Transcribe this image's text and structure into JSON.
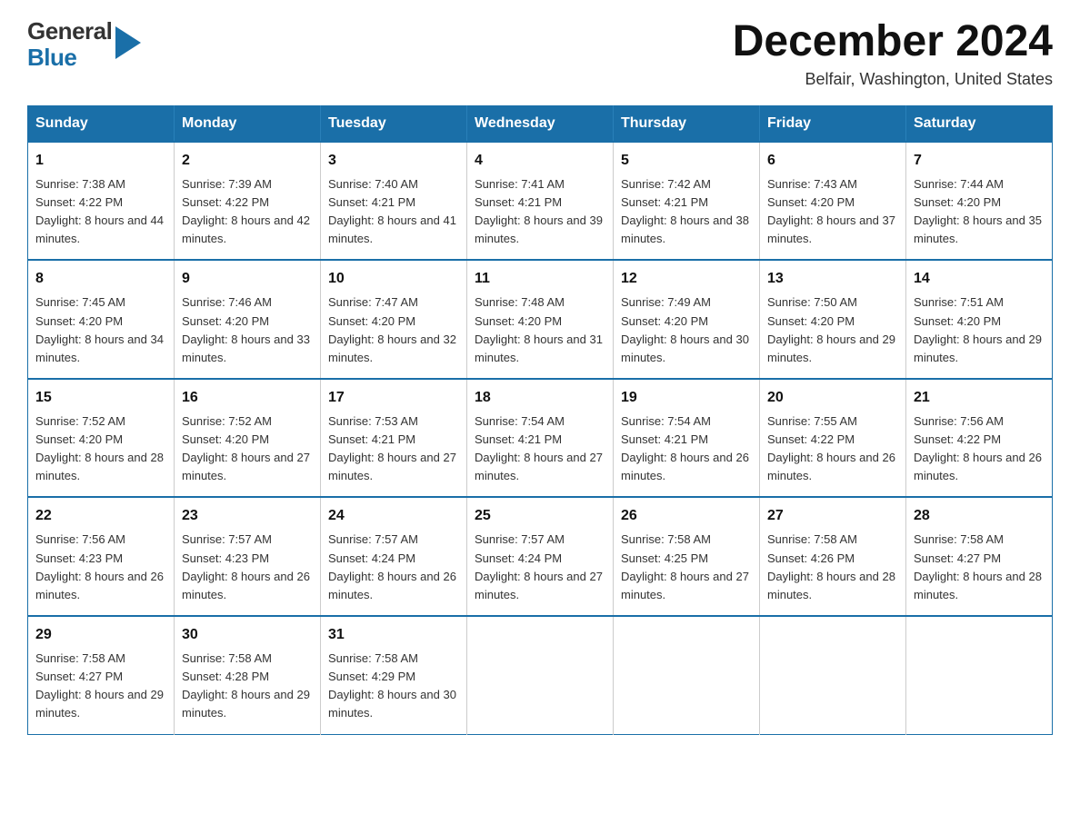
{
  "header": {
    "logo": {
      "general": "General",
      "blue": "Blue",
      "arrow": "▶"
    },
    "title": "December 2024",
    "subtitle": "Belfair, Washington, United States"
  },
  "days_of_week": [
    "Sunday",
    "Monday",
    "Tuesday",
    "Wednesday",
    "Thursday",
    "Friday",
    "Saturday"
  ],
  "weeks": [
    [
      {
        "day": "1",
        "sunrise": "Sunrise: 7:38 AM",
        "sunset": "Sunset: 4:22 PM",
        "daylight": "Daylight: 8 hours and 44 minutes."
      },
      {
        "day": "2",
        "sunrise": "Sunrise: 7:39 AM",
        "sunset": "Sunset: 4:22 PM",
        "daylight": "Daylight: 8 hours and 42 minutes."
      },
      {
        "day": "3",
        "sunrise": "Sunrise: 7:40 AM",
        "sunset": "Sunset: 4:21 PM",
        "daylight": "Daylight: 8 hours and 41 minutes."
      },
      {
        "day": "4",
        "sunrise": "Sunrise: 7:41 AM",
        "sunset": "Sunset: 4:21 PM",
        "daylight": "Daylight: 8 hours and 39 minutes."
      },
      {
        "day": "5",
        "sunrise": "Sunrise: 7:42 AM",
        "sunset": "Sunset: 4:21 PM",
        "daylight": "Daylight: 8 hours and 38 minutes."
      },
      {
        "day": "6",
        "sunrise": "Sunrise: 7:43 AM",
        "sunset": "Sunset: 4:20 PM",
        "daylight": "Daylight: 8 hours and 37 minutes."
      },
      {
        "day": "7",
        "sunrise": "Sunrise: 7:44 AM",
        "sunset": "Sunset: 4:20 PM",
        "daylight": "Daylight: 8 hours and 35 minutes."
      }
    ],
    [
      {
        "day": "8",
        "sunrise": "Sunrise: 7:45 AM",
        "sunset": "Sunset: 4:20 PM",
        "daylight": "Daylight: 8 hours and 34 minutes."
      },
      {
        "day": "9",
        "sunrise": "Sunrise: 7:46 AM",
        "sunset": "Sunset: 4:20 PM",
        "daylight": "Daylight: 8 hours and 33 minutes."
      },
      {
        "day": "10",
        "sunrise": "Sunrise: 7:47 AM",
        "sunset": "Sunset: 4:20 PM",
        "daylight": "Daylight: 8 hours and 32 minutes."
      },
      {
        "day": "11",
        "sunrise": "Sunrise: 7:48 AM",
        "sunset": "Sunset: 4:20 PM",
        "daylight": "Daylight: 8 hours and 31 minutes."
      },
      {
        "day": "12",
        "sunrise": "Sunrise: 7:49 AM",
        "sunset": "Sunset: 4:20 PM",
        "daylight": "Daylight: 8 hours and 30 minutes."
      },
      {
        "day": "13",
        "sunrise": "Sunrise: 7:50 AM",
        "sunset": "Sunset: 4:20 PM",
        "daylight": "Daylight: 8 hours and 29 minutes."
      },
      {
        "day": "14",
        "sunrise": "Sunrise: 7:51 AM",
        "sunset": "Sunset: 4:20 PM",
        "daylight": "Daylight: 8 hours and 29 minutes."
      }
    ],
    [
      {
        "day": "15",
        "sunrise": "Sunrise: 7:52 AM",
        "sunset": "Sunset: 4:20 PM",
        "daylight": "Daylight: 8 hours and 28 minutes."
      },
      {
        "day": "16",
        "sunrise": "Sunrise: 7:52 AM",
        "sunset": "Sunset: 4:20 PM",
        "daylight": "Daylight: 8 hours and 27 minutes."
      },
      {
        "day": "17",
        "sunrise": "Sunrise: 7:53 AM",
        "sunset": "Sunset: 4:21 PM",
        "daylight": "Daylight: 8 hours and 27 minutes."
      },
      {
        "day": "18",
        "sunrise": "Sunrise: 7:54 AM",
        "sunset": "Sunset: 4:21 PM",
        "daylight": "Daylight: 8 hours and 27 minutes."
      },
      {
        "day": "19",
        "sunrise": "Sunrise: 7:54 AM",
        "sunset": "Sunset: 4:21 PM",
        "daylight": "Daylight: 8 hours and 26 minutes."
      },
      {
        "day": "20",
        "sunrise": "Sunrise: 7:55 AM",
        "sunset": "Sunset: 4:22 PM",
        "daylight": "Daylight: 8 hours and 26 minutes."
      },
      {
        "day": "21",
        "sunrise": "Sunrise: 7:56 AM",
        "sunset": "Sunset: 4:22 PM",
        "daylight": "Daylight: 8 hours and 26 minutes."
      }
    ],
    [
      {
        "day": "22",
        "sunrise": "Sunrise: 7:56 AM",
        "sunset": "Sunset: 4:23 PM",
        "daylight": "Daylight: 8 hours and 26 minutes."
      },
      {
        "day": "23",
        "sunrise": "Sunrise: 7:57 AM",
        "sunset": "Sunset: 4:23 PM",
        "daylight": "Daylight: 8 hours and 26 minutes."
      },
      {
        "day": "24",
        "sunrise": "Sunrise: 7:57 AM",
        "sunset": "Sunset: 4:24 PM",
        "daylight": "Daylight: 8 hours and 26 minutes."
      },
      {
        "day": "25",
        "sunrise": "Sunrise: 7:57 AM",
        "sunset": "Sunset: 4:24 PM",
        "daylight": "Daylight: 8 hours and 27 minutes."
      },
      {
        "day": "26",
        "sunrise": "Sunrise: 7:58 AM",
        "sunset": "Sunset: 4:25 PM",
        "daylight": "Daylight: 8 hours and 27 minutes."
      },
      {
        "day": "27",
        "sunrise": "Sunrise: 7:58 AM",
        "sunset": "Sunset: 4:26 PM",
        "daylight": "Daylight: 8 hours and 28 minutes."
      },
      {
        "day": "28",
        "sunrise": "Sunrise: 7:58 AM",
        "sunset": "Sunset: 4:27 PM",
        "daylight": "Daylight: 8 hours and 28 minutes."
      }
    ],
    [
      {
        "day": "29",
        "sunrise": "Sunrise: 7:58 AM",
        "sunset": "Sunset: 4:27 PM",
        "daylight": "Daylight: 8 hours and 29 minutes."
      },
      {
        "day": "30",
        "sunrise": "Sunrise: 7:58 AM",
        "sunset": "Sunset: 4:28 PM",
        "daylight": "Daylight: 8 hours and 29 minutes."
      },
      {
        "day": "31",
        "sunrise": "Sunrise: 7:58 AM",
        "sunset": "Sunset: 4:29 PM",
        "daylight": "Daylight: 8 hours and 30 minutes."
      },
      null,
      null,
      null,
      null
    ]
  ]
}
